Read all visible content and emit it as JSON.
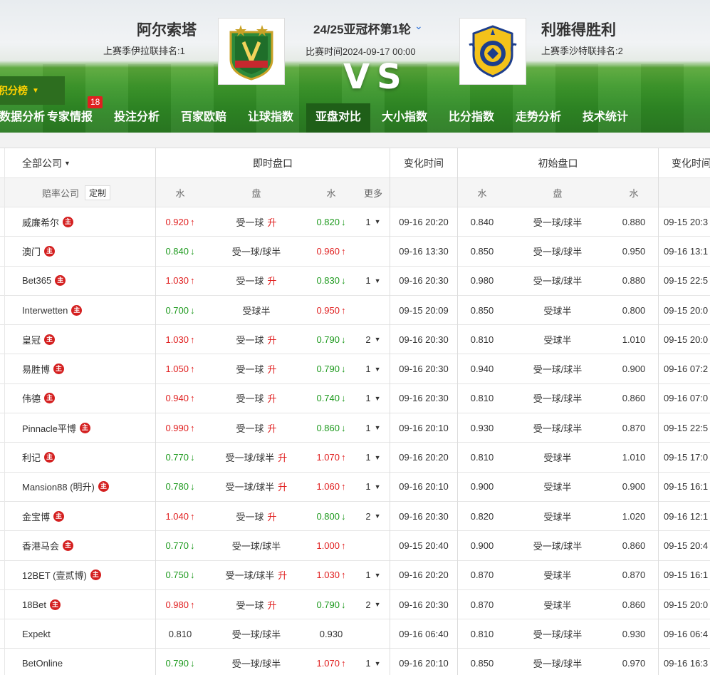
{
  "header": {
    "home_team": "阿尔索塔",
    "home_rank": "上赛季伊拉联排名:1",
    "away_team": "利雅得胜利",
    "away_rank": "上赛季沙特联排名:2",
    "match_title": "24/25亚冠杯第1轮",
    "match_time": "比赛时间2024-09-17 00:00",
    "vs": "VS",
    "standings_label": "积分榜"
  },
  "nav": {
    "items": [
      "数据分析",
      "专家情报",
      "投注分析",
      "百家欧赔",
      "让球指数",
      "亚盘对比",
      "大小指数",
      "比分指数",
      "走势分析",
      "技术统计"
    ],
    "active_index": 5,
    "expert_badge": "18"
  },
  "table": {
    "company_filter": "全部公司",
    "col_live": "即时盘口",
    "col_change_time": "变化时间",
    "col_initial": "初始盘口",
    "col_change_time2": "变化时间",
    "sub_company": "赔率公司",
    "sub_custom": "定制",
    "sub_water": "水",
    "sub_line": "盘",
    "sub_water2": "水",
    "sub_more": "更多",
    "sub_water3": "水",
    "sub_line2": "盘",
    "sub_water4": "水",
    "home_marker": "主",
    "up_label": "升",
    "rows": [
      {
        "company": "威廉希尔",
        "live_w1": "0.920",
        "w1_dir": "up",
        "live_line": "受一球",
        "line_up": true,
        "live_w2": "0.820",
        "w2_dir": "down",
        "more": "1",
        "time": "09-16 20:20",
        "init_w1": "0.840",
        "init_line": "受一球/球半",
        "init_w2": "0.880",
        "time2": "09-15 20:3"
      },
      {
        "company": "澳门",
        "live_w1": "0.840",
        "w1_dir": "down",
        "live_line": "受一球/球半",
        "line_up": false,
        "live_w2": "0.960",
        "w2_dir": "up",
        "more": "",
        "time": "09-16 13:30",
        "init_w1": "0.850",
        "init_line": "受一球/球半",
        "init_w2": "0.950",
        "time2": "09-16 13:1"
      },
      {
        "company": "Bet365",
        "live_w1": "1.030",
        "w1_dir": "up",
        "live_line": "受一球",
        "line_up": true,
        "live_w2": "0.830",
        "w2_dir": "down",
        "more": "1",
        "time": "09-16 20:30",
        "init_w1": "0.980",
        "init_line": "受一球/球半",
        "init_w2": "0.880",
        "time2": "09-15 22:5"
      },
      {
        "company": "Interwetten",
        "live_w1": "0.700",
        "w1_dir": "down",
        "live_line": "受球半",
        "line_up": false,
        "live_w2": "0.950",
        "w2_dir": "up",
        "more": "",
        "time": "09-15 20:09",
        "init_w1": "0.850",
        "init_line": "受球半",
        "init_w2": "0.800",
        "time2": "09-15 20:0"
      },
      {
        "company": "皇冠",
        "live_w1": "1.030",
        "w1_dir": "up",
        "live_line": "受一球",
        "line_up": true,
        "live_w2": "0.790",
        "w2_dir": "down",
        "more": "2",
        "time": "09-16 20:30",
        "init_w1": "0.810",
        "init_line": "受球半",
        "init_w2": "1.010",
        "time2": "09-15 20:0"
      },
      {
        "company": "易胜博",
        "live_w1": "1.050",
        "w1_dir": "up",
        "live_line": "受一球",
        "line_up": true,
        "live_w2": "0.790",
        "w2_dir": "down",
        "more": "1",
        "time": "09-16 20:30",
        "init_w1": "0.940",
        "init_line": "受一球/球半",
        "init_w2": "0.900",
        "time2": "09-16 07:2"
      },
      {
        "company": "伟德",
        "live_w1": "0.940",
        "w1_dir": "up",
        "live_line": "受一球",
        "line_up": true,
        "live_w2": "0.740",
        "w2_dir": "down",
        "more": "1",
        "time": "09-16 20:30",
        "init_w1": "0.810",
        "init_line": "受一球/球半",
        "init_w2": "0.860",
        "time2": "09-16 07:0"
      },
      {
        "company": "Pinnacle平博",
        "live_w1": "0.990",
        "w1_dir": "up",
        "live_line": "受一球",
        "line_up": true,
        "live_w2": "0.860",
        "w2_dir": "down",
        "more": "1",
        "time": "09-16 20:10",
        "init_w1": "0.930",
        "init_line": "受一球/球半",
        "init_w2": "0.870",
        "time2": "09-15 22:5"
      },
      {
        "company": "利记",
        "live_w1": "0.770",
        "w1_dir": "down",
        "live_line": "受一球/球半",
        "line_up": true,
        "live_w2": "1.070",
        "w2_dir": "up",
        "more": "1",
        "time": "09-16 20:20",
        "init_w1": "0.810",
        "init_line": "受球半",
        "init_w2": "1.010",
        "time2": "09-15 17:0"
      },
      {
        "company": "Mansion88 (明升)",
        "live_w1": "0.780",
        "w1_dir": "down",
        "live_line": "受一球/球半",
        "line_up": true,
        "live_w2": "1.060",
        "w2_dir": "up",
        "more": "1",
        "time": "09-16 20:10",
        "init_w1": "0.900",
        "init_line": "受球半",
        "init_w2": "0.900",
        "time2": "09-15 16:1"
      },
      {
        "company": "金宝博",
        "live_w1": "1.040",
        "w1_dir": "up",
        "live_line": "受一球",
        "line_up": true,
        "live_w2": "0.800",
        "w2_dir": "down",
        "more": "2",
        "time": "09-16 20:30",
        "init_w1": "0.820",
        "init_line": "受球半",
        "init_w2": "1.020",
        "time2": "09-16 12:1"
      },
      {
        "company": "香港马会",
        "live_w1": "0.770",
        "w1_dir": "down",
        "live_line": "受一球/球半",
        "line_up": false,
        "live_w2": "1.000",
        "w2_dir": "up",
        "more": "",
        "time": "09-15 20:40",
        "init_w1": "0.900",
        "init_line": "受一球/球半",
        "init_w2": "0.860",
        "time2": "09-15 20:4"
      },
      {
        "company": "12BET (壹贰博)",
        "live_w1": "0.750",
        "w1_dir": "down",
        "live_line": "受一球/球半",
        "line_up": true,
        "live_w2": "1.030",
        "w2_dir": "up",
        "more": "1",
        "time": "09-16 20:20",
        "init_w1": "0.870",
        "init_line": "受球半",
        "init_w2": "0.870",
        "time2": "09-15 16:1"
      },
      {
        "company": "18Bet",
        "live_w1": "0.980",
        "w1_dir": "up",
        "live_line": "受一球",
        "line_up": true,
        "live_w2": "0.790",
        "w2_dir": "down",
        "more": "2",
        "time": "09-16 20:30",
        "init_w1": "0.870",
        "init_line": "受球半",
        "init_w2": "0.860",
        "time2": "09-15 20:0"
      },
      {
        "company": "Expekt",
        "live_w1": "0.810",
        "w1_dir": "none",
        "live_line": "受一球/球半",
        "line_up": false,
        "live_w2": "0.930",
        "w2_dir": "none",
        "more": "",
        "time": "09-16 06:40",
        "init_w1": "0.810",
        "init_line": "受一球/球半",
        "init_w2": "0.930",
        "time2": "09-16 06:4",
        "no_marker": true
      },
      {
        "company": "BetOnline",
        "live_w1": "0.790",
        "w1_dir": "down",
        "live_line": "受一球/球半",
        "line_up": false,
        "live_w2": "1.070",
        "w2_dir": "up",
        "more": "1",
        "time": "09-16 20:10",
        "init_w1": "0.850",
        "init_line": "受一球/球半",
        "init_w2": "0.970",
        "time2": "09-16 16:3",
        "no_marker": true
      }
    ]
  },
  "colors": {
    "up": "#e02020",
    "down": "#1f9a1f",
    "accent": "#ffd200",
    "nav_active": "#1f5f18"
  }
}
